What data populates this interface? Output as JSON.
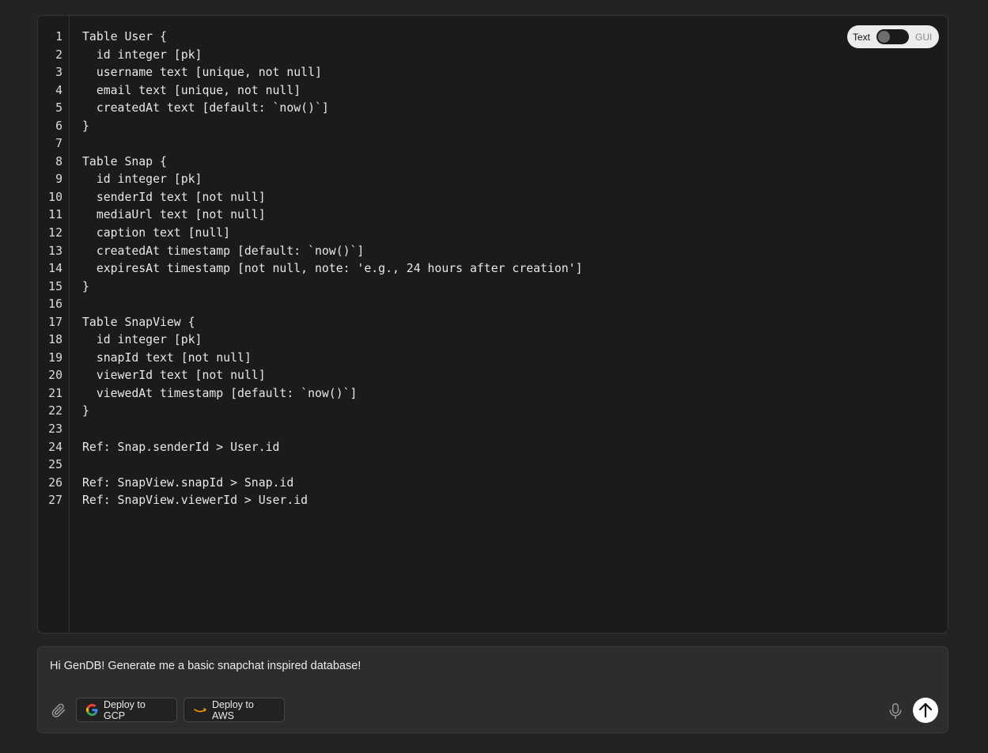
{
  "editor": {
    "line_numbers": [
      "1",
      "2",
      "3",
      "4",
      "5",
      "6",
      "7",
      "8",
      "9",
      "10",
      "11",
      "12",
      "13",
      "14",
      "15",
      "16",
      "17",
      "18",
      "19",
      "20",
      "21",
      "22",
      "23",
      "24",
      "25",
      "26",
      "27"
    ],
    "lines": [
      "Table User {",
      "  id integer [pk]",
      "  username text [unique, not null]",
      "  email text [unique, not null]",
      "  createdAt text [default: `now()`]",
      "}",
      "",
      "Table Snap {",
      "  id integer [pk]",
      "  senderId text [not null]",
      "  mediaUrl text [not null]",
      "  caption text [null]",
      "  createdAt timestamp [default: `now()`]",
      "  expiresAt timestamp [not null, note: 'e.g., 24 hours after creation']",
      "}",
      "",
      "Table SnapView {",
      "  id integer [pk]",
      "  snapId text [not null]",
      "  viewerId text [not null]",
      "  viewedAt timestamp [default: `now()`]",
      "}",
      "",
      "Ref: Snap.senderId > User.id",
      "",
      "Ref: SnapView.snapId > Snap.id",
      "Ref: SnapView.viewerId > User.id"
    ]
  },
  "mode_toggle": {
    "left_label": "Text",
    "right_label": "GUI"
  },
  "composer": {
    "prompt": "Hi GenDB! Generate me a basic snapchat inspired database!",
    "deploy_gcp_label": "Deploy to GCP",
    "deploy_aws_label": "Deploy to AWS",
    "icons": [
      "paperclip-icon",
      "google-logo-icon",
      "amazon-logo-icon",
      "microphone-icon",
      "arrow-up-icon"
    ]
  }
}
